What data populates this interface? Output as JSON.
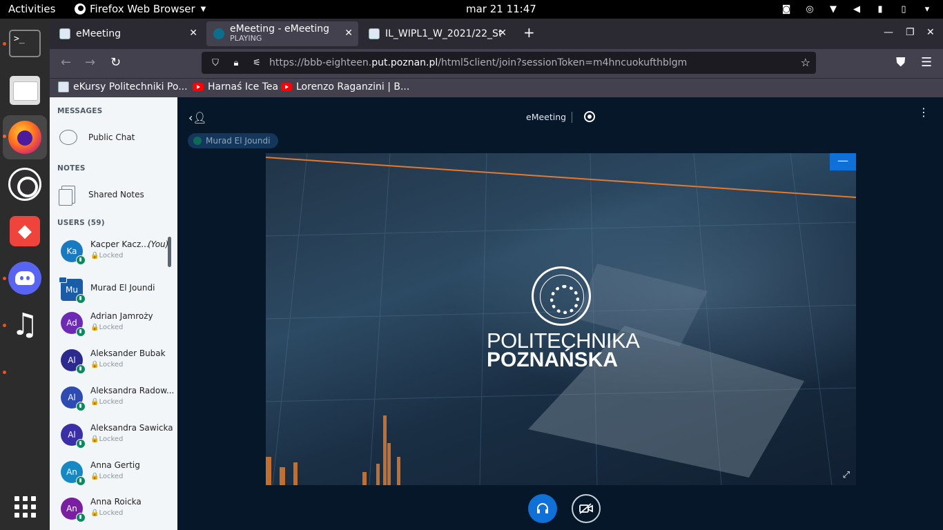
{
  "topbar": {
    "activities": "Activities",
    "app_name": "Firefox Web Browser",
    "clock": "mar 21  11:47"
  },
  "browser": {
    "tabs": [
      {
        "title": "eMeeting",
        "subtitle": ""
      },
      {
        "title": "eMeeting - eMeeting",
        "subtitle": "PLAYING"
      },
      {
        "title": "IL_WIPL1_W_2021/22_St",
        "subtitle": ""
      }
    ],
    "url_prefix": "https://bbb-eighteen.",
    "url_domain": "put.poznan.pl",
    "url_path": "/html5client/join?sessionToken=m4hncuokufthblgm",
    "bookmarks": [
      "eKursy Politechniki Po...",
      "Harnaś Ice Tea",
      "Lorenzo Raganzini | B..."
    ]
  },
  "sidebar": {
    "messages_title": "MESSAGES",
    "public_chat": "Public Chat",
    "notes_title": "NOTES",
    "shared_notes": "Shared Notes",
    "users_title": "USERS (59)",
    "users": [
      {
        "initials": "Ka",
        "name": "Kacper Kacz...",
        "you": "(You)",
        "status": "🔒Locked",
        "color": "#1a7ac1"
      },
      {
        "initials": "Mu",
        "name": "Murad El Joundi",
        "status": "",
        "color": "#1b5ca8"
      },
      {
        "initials": "Ad",
        "name": "Adrian Jamroży",
        "status": "🔒Locked",
        "color": "#6d2bb5"
      },
      {
        "initials": "Al",
        "name": "Aleksander Bubak",
        "status": "🔒Locked",
        "color": "#2d2a8f"
      },
      {
        "initials": "Al",
        "name": "Aleksandra Radow...",
        "status": "🔒Locked",
        "color": "#2d4bb0"
      },
      {
        "initials": "Al",
        "name": "Aleksandra Sawicka",
        "status": "🔒Locked",
        "color": "#3b2fa8"
      },
      {
        "initials": "An",
        "name": "Anna Gertig",
        "status": "🔒Locked",
        "color": "#1688c4"
      },
      {
        "initials": "An",
        "name": "Anna Roicka",
        "status": "🔒Locked",
        "color": "#7b1fa2"
      }
    ]
  },
  "meeting": {
    "title": "eMeeting",
    "talker": "Murad El Joundi",
    "slide_line1": "POLITECHNIKA",
    "slide_line2": "POZNAŃSKA"
  }
}
